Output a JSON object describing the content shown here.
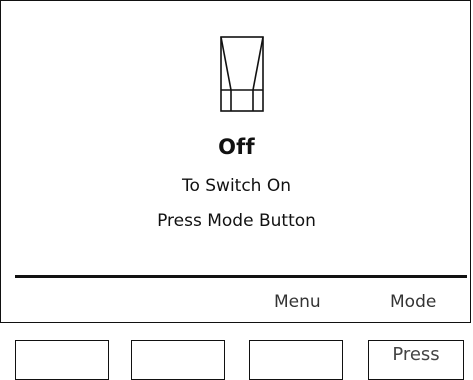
{
  "status": {
    "icon": "rocker-switch-icon",
    "title": "Off",
    "line1": "To Switch On",
    "line2": "Press Mode Button"
  },
  "softkeys": {
    "menu_label": "Menu",
    "mode_label": "Mode"
  },
  "buttons": {
    "press_label": "Press"
  }
}
